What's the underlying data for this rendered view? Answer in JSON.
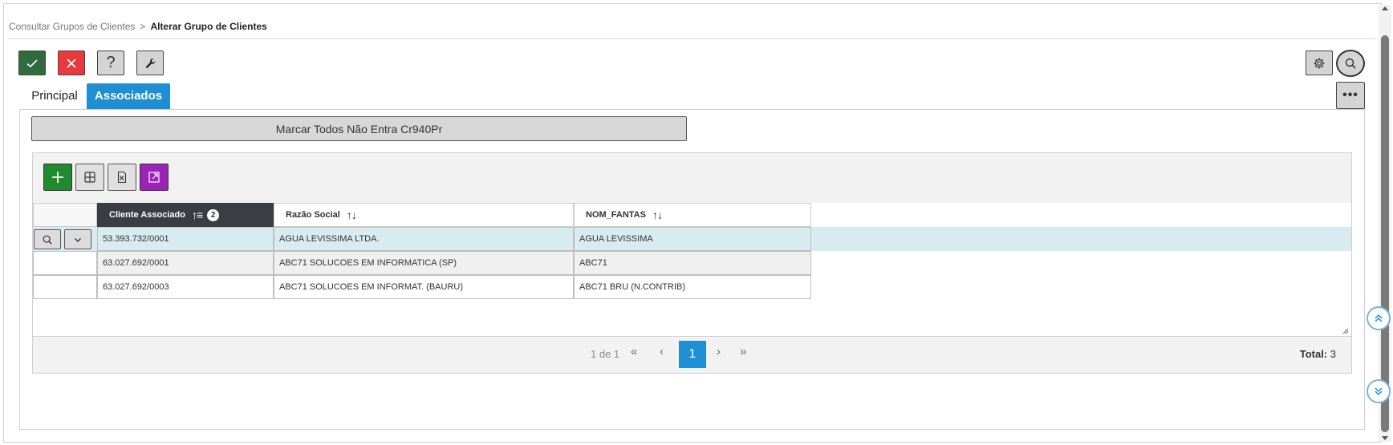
{
  "breadcrumb": {
    "parent": "Consultar Grupos de Clientes",
    "separator": ">",
    "current": "Alterar Grupo de Clientes"
  },
  "toolbar": {
    "help_label": "?",
    "more_label": "•••"
  },
  "tabs": [
    {
      "label": "Principal",
      "active": false
    },
    {
      "label": "Associados",
      "active": true
    }
  ],
  "mark_all_label": "Marcar Todos Não Entra Cr940Pr",
  "grid": {
    "columns": [
      {
        "label": "Cliente Associado",
        "sort": "ascending",
        "sort_order": "2"
      },
      {
        "label": "Razão Social",
        "sort": "none"
      },
      {
        "label": "NOM_FANTAS",
        "sort": "none"
      }
    ],
    "rows": [
      {
        "cliente": "53.393.732/0001",
        "razao": "AGUA LEVISSIMA LTDA.",
        "fantasia": "AGUA LEVISSIMA",
        "selected": true
      },
      {
        "cliente": "63.027.692/0001",
        "razao": "ABC71 SOLUCOES EM INFORMATICA (SP)",
        "fantasia": "ABC71",
        "selected": false
      },
      {
        "cliente": "63.027.692/0003",
        "razao": "ABC71 SOLUCOES EM INFORMAT. (BAURU)",
        "fantasia": "ABC71 BRU (N.CONTRIB)",
        "selected": false
      }
    ],
    "pager": {
      "info": "1 de 1",
      "first": "«",
      "prev": "‹",
      "current_page": "1",
      "next": "›",
      "last": "»",
      "total_label": "Total:",
      "total_value": "3"
    }
  },
  "colors": {
    "confirm": "#2f6b3f",
    "cancel": "#e8393c",
    "accent": "#1e8fd4",
    "add": "#1f8a2e",
    "expand": "#9b23b7",
    "selected_row": "#d8ebf0",
    "sorted_header": "#3a3d42"
  }
}
